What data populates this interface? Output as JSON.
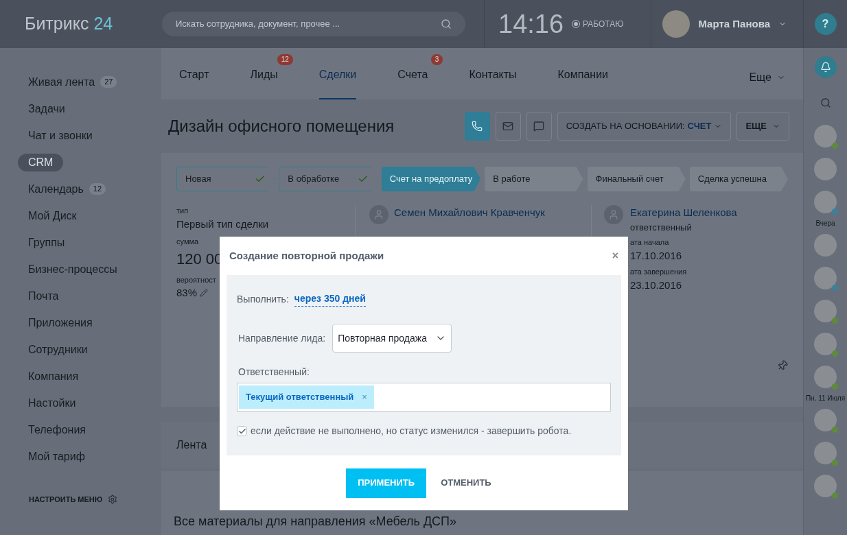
{
  "header": {
    "logo": {
      "text": "Битрикс",
      "accent": "24"
    },
    "search": {
      "placeholder": "Искать сотрудника, документ, прочее ..."
    },
    "time": "14:16",
    "work_status": "РАБОТАЮ",
    "user": {
      "name": "Марта Панова"
    },
    "help": "?"
  },
  "sidebar": {
    "items": [
      {
        "label": "Живая лента",
        "counter": "27",
        "selected": false
      },
      {
        "label": "Задачи",
        "selected": false
      },
      {
        "label": "Чат и звонки",
        "selected": false
      },
      {
        "label": "CRM",
        "selected": true
      },
      {
        "label": "Календарь",
        "counter": "12",
        "selected": false
      },
      {
        "label": "Мой Диск",
        "selected": false
      },
      {
        "label": "Группы",
        "selected": false
      },
      {
        "label": "Бизнес-процессы",
        "selected": false
      },
      {
        "label": "Почта",
        "selected": false
      },
      {
        "label": "Приложения",
        "selected": false
      },
      {
        "label": "Сотрудники",
        "selected": false
      },
      {
        "label": "Компания",
        "selected": false
      },
      {
        "label": "Настойки",
        "selected": false
      },
      {
        "label": "Телефония",
        "selected": false
      },
      {
        "label": "Мой тариф",
        "selected": false
      }
    ],
    "configure": "НАСТРОИТЬ МЕНЮ"
  },
  "tabs": [
    {
      "label": "Старт",
      "selected": false
    },
    {
      "label": "Лиды",
      "badge": "12",
      "selected": false
    },
    {
      "label": "Сделки",
      "selected": true
    },
    {
      "label": "Счета",
      "badge": "3",
      "selected": false
    },
    {
      "label": "Контакты",
      "selected": false
    },
    {
      "label": "Компании",
      "selected": false
    }
  ],
  "more_tab": "Еще",
  "deal": {
    "title": "Дизайн офисного помещения",
    "actions": [
      {
        "kind": "phone",
        "selected": true
      },
      {
        "kind": "mail",
        "selected": false
      },
      {
        "kind": "chat",
        "selected": false
      }
    ],
    "create_button": {
      "label": "СОЗДАТЬ НА ОСНОВАНИИ:",
      "value": "СЧЕТ"
    },
    "more_button": "ЕЩЕ",
    "stages": [
      {
        "label": "Новая",
        "done": true,
        "selected": false
      },
      {
        "label": "В обработке",
        "done": true,
        "selected": false
      },
      {
        "label": "Счет на предоплату",
        "done": false,
        "selected": true
      },
      {
        "label": "В работе",
        "done": false,
        "selected": false
      },
      {
        "label": "Финальный счет",
        "done": false,
        "selected": false
      },
      {
        "label": "Сделка успешна",
        "done": false,
        "selected": false
      }
    ],
    "fields": [
      {
        "label": "тип",
        "value": "Первый тип сделки"
      },
      {
        "label": "сумма",
        "value": "120 00",
        "large": true
      },
      {
        "label": "вероятност",
        "value": "83%",
        "editable": true
      }
    ],
    "contact": {
      "name": "Семен Михайлович Кравченчук"
    },
    "responsible": {
      "name": "Екатерина Шеленкова",
      "role": "ответственный",
      "fields": [
        {
          "label": "ата начала",
          "value": "17.10.2016"
        },
        {
          "label": "ата завершения",
          "value": "23.10.2016"
        }
      ]
    }
  },
  "feed": {
    "title": "Лента",
    "text": "Все материалы для направления «Мебель ДСП»"
  },
  "rail": [
    {
      "kind": "avatar",
      "color": "#5f8a3c"
    },
    {
      "kind": "avatar"
    },
    {
      "kind": "avatar",
      "color": "#3f7f9a"
    },
    {
      "kind": "date",
      "label": "Вчера"
    },
    {
      "kind": "avatar"
    },
    {
      "kind": "avatar",
      "color": "#3f7f9a"
    },
    {
      "kind": "avatar",
      "color": "#5f8a3c"
    },
    {
      "kind": "avatar",
      "color": "#5f8a3c"
    },
    {
      "kind": "avatar",
      "color": "#5f8a3c"
    },
    {
      "kind": "date",
      "label": "Пн. 11 Июля"
    },
    {
      "kind": "avatar",
      "color": "#5f8a3c"
    },
    {
      "kind": "avatar",
      "color": "#5f8a3c"
    },
    {
      "kind": "avatar",
      "color": "#5f8a3c"
    }
  ],
  "dialog": {
    "title": "Создание повторной продажи",
    "close": "×",
    "run_label": "Выполнить:",
    "run_value": "через 350 дней",
    "direction_label": "Направление лида:",
    "direction_value": "Повторная продажа",
    "responsible_label": "Ответственный:",
    "responsible_tag": "Текущий ответственный",
    "tag_remove": "×",
    "finish_robot": {
      "label": "если действие не выполнено, но статус изменился - завершить робота.",
      "checked": true
    },
    "apply": "ПРИМЕНИТЬ",
    "cancel": "ОТМЕНИТЬ"
  }
}
